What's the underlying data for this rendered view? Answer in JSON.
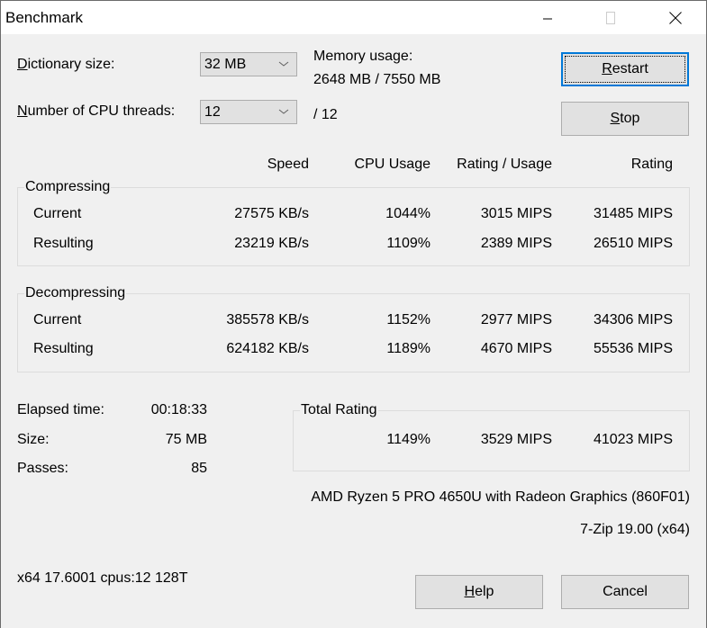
{
  "window": {
    "title": "Benchmark",
    "controls": {
      "minimize": "minimize-icon",
      "maximize": "maximize-icon",
      "close": "close-icon"
    }
  },
  "settings": {
    "dictionary_label_mnemonic": "D",
    "dictionary_label_rest": "ictionary size:",
    "dictionary_value": "32 MB",
    "threads_label_mnemonic": "N",
    "threads_label_rest": "umber of CPU threads:",
    "threads_value": "12",
    "threads_max": "/ 12",
    "memory_label": "Memory usage:",
    "memory_value": "2648 MB / 7550 MB"
  },
  "buttons": {
    "restart_mnemonic": "R",
    "restart_rest": "estart",
    "stop_mnemonic": "S",
    "stop_rest": "top",
    "help_mnemonic": "H",
    "help_rest": "elp",
    "cancel": "Cancel"
  },
  "columns": [
    "Speed",
    "CPU Usage",
    "Rating / Usage",
    "Rating"
  ],
  "compressing": {
    "label": "Compressing",
    "rows": [
      {
        "name": "Current",
        "speed": "27575 KB/s",
        "cpu": "1044%",
        "rating_usage": "3015 MIPS",
        "rating": "31485 MIPS"
      },
      {
        "name": "Resulting",
        "speed": "23219 KB/s",
        "cpu": "1109%",
        "rating_usage": "2389 MIPS",
        "rating": "26510 MIPS"
      }
    ]
  },
  "decompressing": {
    "label": "Decompressing",
    "rows": [
      {
        "name": "Current",
        "speed": "385578 KB/s",
        "cpu": "1152%",
        "rating_usage": "2977 MIPS",
        "rating": "34306 MIPS"
      },
      {
        "name": "Resulting",
        "speed": "624182 KB/s",
        "cpu": "1189%",
        "rating_usage": "4670 MIPS",
        "rating": "55536 MIPS"
      }
    ]
  },
  "stats": {
    "elapsed_label": "Elapsed time:",
    "elapsed_value": "00:18:33",
    "size_label": "Size:",
    "size_value": "75 MB",
    "passes_label": "Passes:",
    "passes_value": "85"
  },
  "total": {
    "label": "Total Rating",
    "cpu": "1149%",
    "rating_usage": "3529 MIPS",
    "rating": "41023 MIPS"
  },
  "system": {
    "cpu_name": "AMD Ryzen 5 PRO 4650U with Radeon Graphics (860F01)",
    "version": "7-Zip 19.00 (x64)",
    "build_info": "x64 17.6001 cpus:12 128T"
  }
}
